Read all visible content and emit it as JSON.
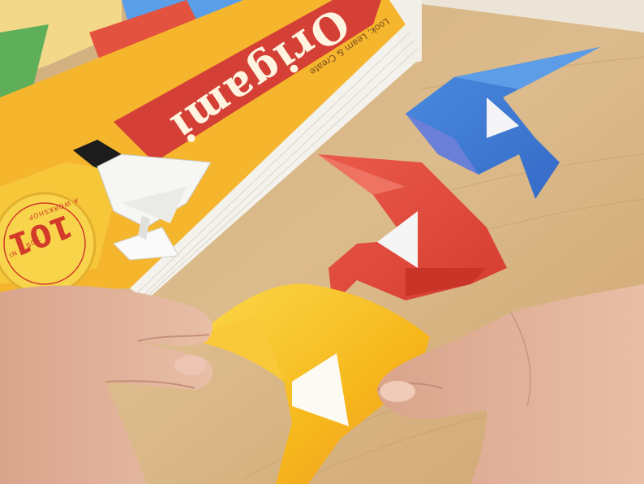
{
  "book": {
    "title": "Origami",
    "subtitle": "Look, Learn & Create",
    "seal_number": "101",
    "seal_text": "A WORKSHOP",
    "seal_text2": "IN A BOX"
  },
  "colors": {
    "table": "#d7b384",
    "book_yellow": "#f4b62a",
    "book_red": "#d8423a",
    "crane_blue": "#3f7fd8",
    "crane_red": "#e24b3e",
    "crane_yellow": "#f4c21d",
    "skin": "#e2b39a"
  },
  "objects": [
    {
      "name": "origami book"
    },
    {
      "name": "blue origami crane"
    },
    {
      "name": "red origami crane"
    },
    {
      "name": "black and white origami figure"
    },
    {
      "name": "yellow origami piece being folded"
    },
    {
      "name": "left hand"
    },
    {
      "name": "right hand"
    }
  ]
}
